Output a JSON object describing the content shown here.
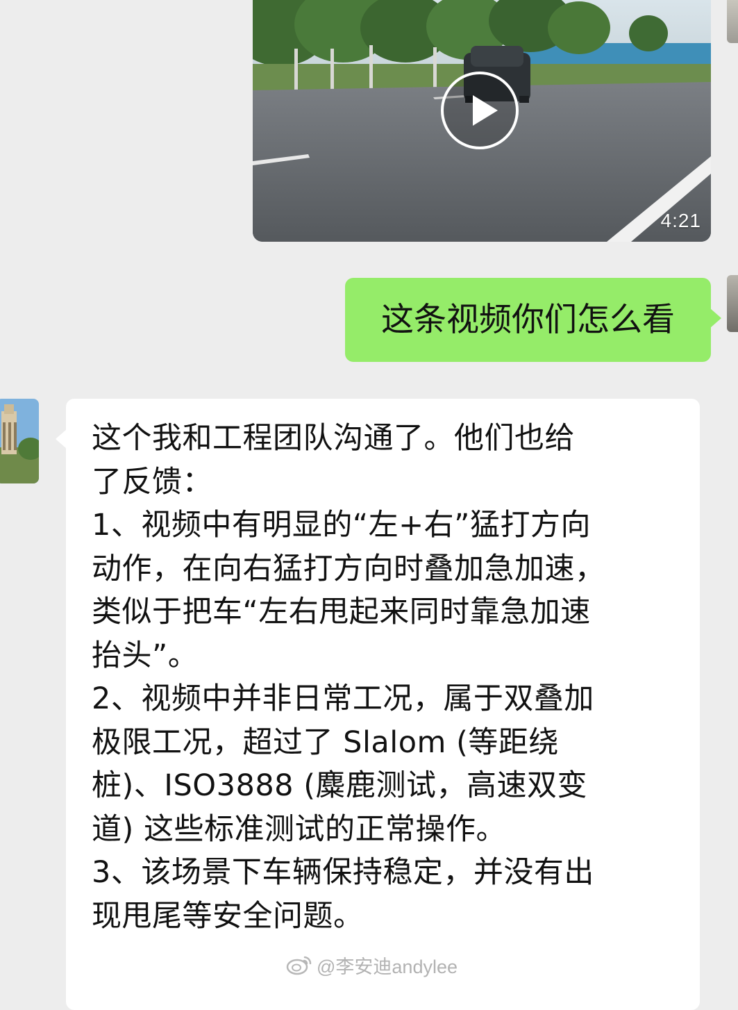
{
  "video_message": {
    "duration": "4:21"
  },
  "outgoing_message": {
    "text": "这条视频你们怎么看"
  },
  "incoming_message": {
    "lines": [
      "这个我和工程团队沟通了。他们也给",
      "了反馈：",
      "1、视频中有明显的“左+右”猛打方向",
      "动作，在向右猛打方向时叠加急加速，",
      "类似于把车“左右甩起来同时靠急加速",
      "抬头”。",
      "2、视频中并非日常工况，属于双叠加",
      "极限工况，超过了 Slalom (等距绕",
      "桩)、ISO3888 (麋鹿测试，高速双变",
      "道) 这些标准测试的正常操作。",
      "3、该场景下车辆保持稳定，并没有出",
      "现甩尾等安全问题。"
    ]
  },
  "watermark": {
    "text": "@李安迪andylee"
  },
  "colors": {
    "chat_background": "#ededed",
    "outgoing_bubble": "#95ec69",
    "incoming_bubble": "#ffffff"
  }
}
